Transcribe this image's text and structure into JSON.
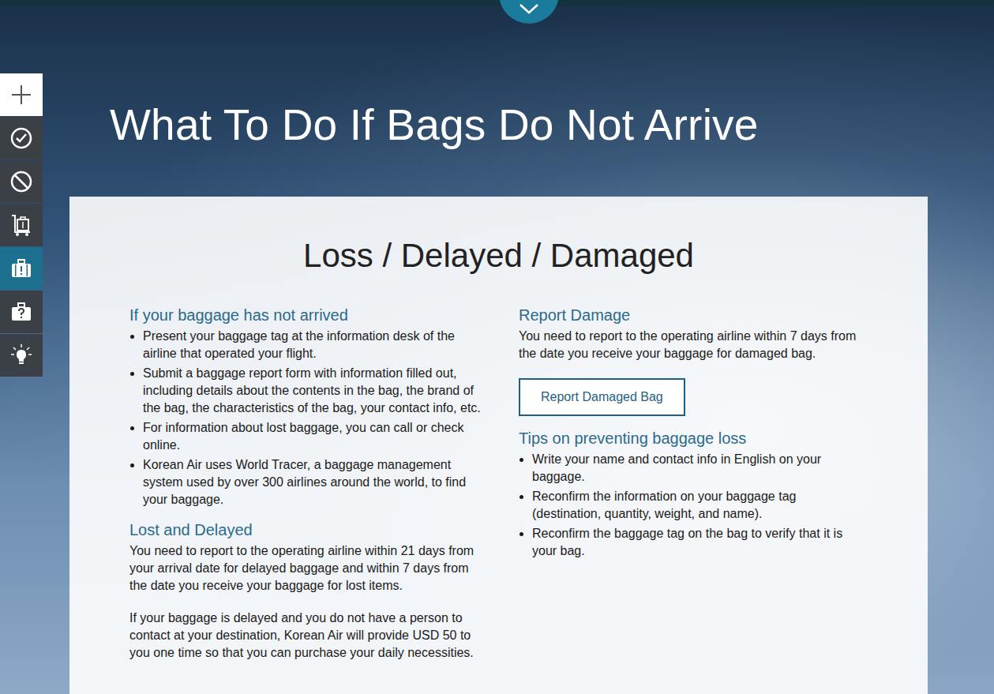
{
  "page": {
    "title": "What To Do If Bags Do Not Arrive"
  },
  "sidebar": {
    "items": [
      {
        "selected": false
      },
      {
        "selected": false
      },
      {
        "selected": false
      },
      {
        "selected": false
      },
      {
        "selected": true
      },
      {
        "selected": false
      },
      {
        "selected": false
      }
    ]
  },
  "card": {
    "heading": "Loss / Delayed / Damaged",
    "not_arrived": {
      "heading": "If your baggage has not arrived",
      "bullets": [
        "Present your baggage tag at the information desk of the airline that operated your flight.",
        "Submit a baggage report form with information filled out, including details about the contents in the bag, the brand of the bag, the characteristics of the bag, your contact info, etc.",
        "For information about lost baggage, you can call or check online.",
        "Korean Air uses World Tracer, a baggage management system used by over 300 airlines around the world, to find your baggage."
      ]
    },
    "lost_delayed": {
      "heading": "Lost and Delayed",
      "paragraphs": [
        "You need to report to the operating airline within 21 days from your arrival date for delayed baggage and within 7 days from the date you receive your baggage for lost items.",
        "If your baggage is delayed and you do not have a person to contact at your destination, Korean Air will provide USD 50 to you one time so that you can purchase your daily necessities."
      ]
    },
    "report_damage": {
      "heading": "Report Damage",
      "text": "You need to report to the operating airline within 7 days from the date you receive your baggage for damaged bag.",
      "button": "Report Damaged Bag"
    },
    "tips": {
      "heading": "Tips on preventing baggage loss",
      "bullets": [
        "Write your name and contact info in English on your baggage.",
        "Reconfirm the information on your baggage tag (destination, quantity, weight, and name).",
        "Reconfirm the baggage tag on the bag to verify that it is your bag."
      ]
    }
  }
}
